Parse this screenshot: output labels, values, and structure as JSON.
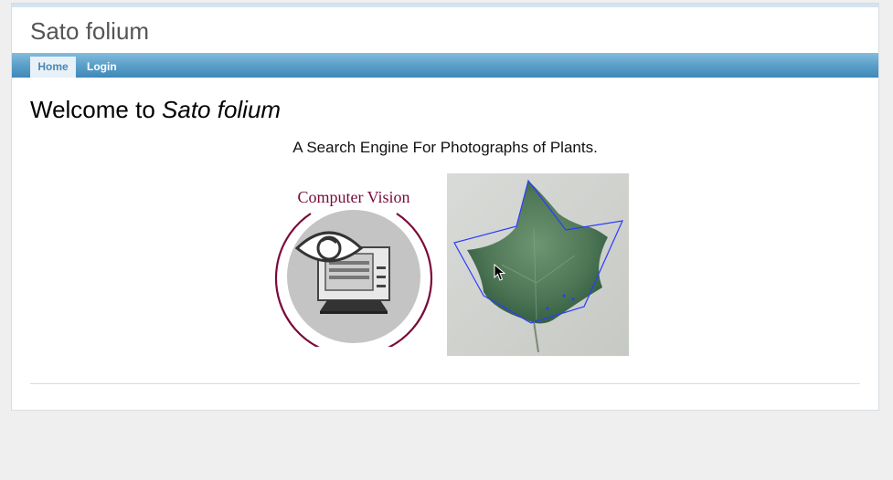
{
  "site": {
    "title": "Sato folium"
  },
  "nav": {
    "items": [
      {
        "label": "Home",
        "active": true
      },
      {
        "label": "Login",
        "active": false
      }
    ]
  },
  "main": {
    "heading_prefix": "Welcome to ",
    "heading_name": "Sato folium",
    "tagline": "A Search Engine For Photographs of Plants."
  },
  "images": {
    "cv_logo_text": "Computer Vision",
    "cv_logo_color": "#7a0a3a",
    "leaf_outline_color": "#2a3cff"
  }
}
